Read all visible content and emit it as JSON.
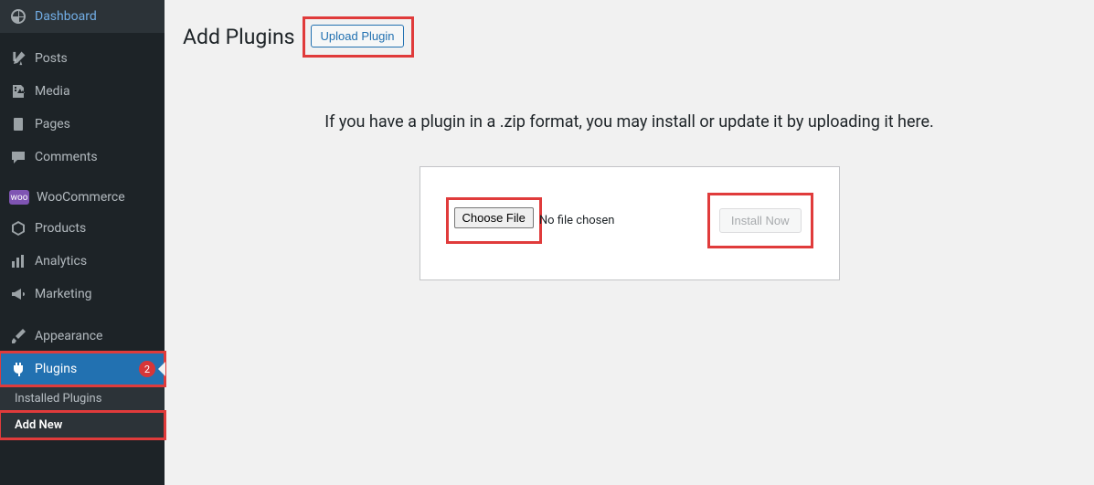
{
  "sidebar": {
    "items": [
      {
        "label": "Dashboard"
      },
      {
        "label": "Posts"
      },
      {
        "label": "Media"
      },
      {
        "label": "Pages"
      },
      {
        "label": "Comments"
      },
      {
        "label": "WooCommerce"
      },
      {
        "label": "Products"
      },
      {
        "label": "Analytics"
      },
      {
        "label": "Marketing"
      },
      {
        "label": "Appearance"
      },
      {
        "label": "Plugins",
        "badge": "2"
      }
    ],
    "submenu": [
      {
        "label": "Installed Plugins"
      },
      {
        "label": "Add New"
      }
    ]
  },
  "header": {
    "title": "Add Plugins",
    "upload_button": "Upload Plugin"
  },
  "main": {
    "instruction": "If you have a plugin in a .zip format, you may install or update it by uploading it here.",
    "choose_file_label": "Choose File",
    "no_file_text": "No file chosen",
    "install_button": "Install Now"
  }
}
